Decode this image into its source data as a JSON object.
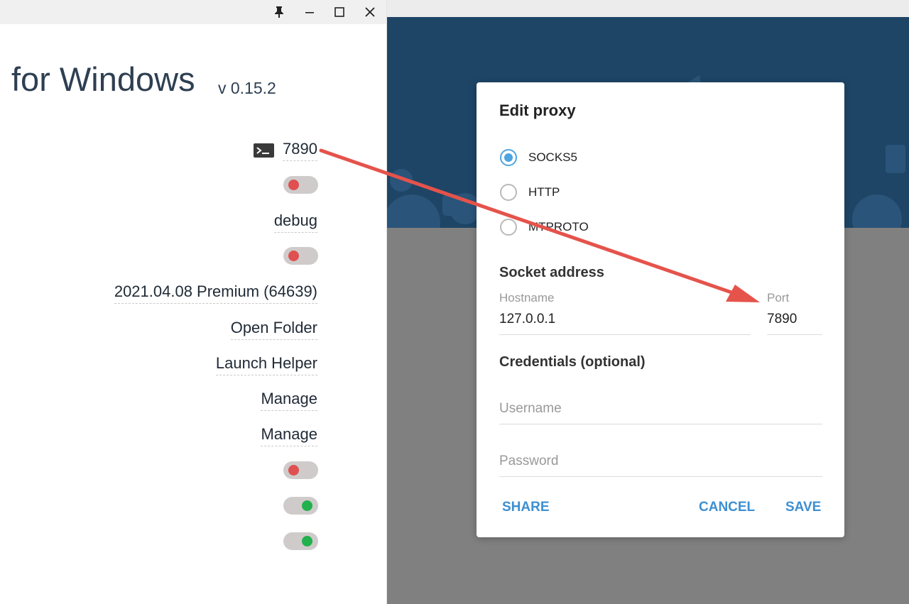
{
  "left_app": {
    "title": "for Windows",
    "version": "v 0.15.2",
    "port": "7890",
    "settings": [
      {
        "type": "toggle",
        "state": "off"
      },
      {
        "type": "link",
        "label": "debug"
      },
      {
        "type": "toggle",
        "state": "off"
      },
      {
        "type": "link",
        "label": "2021.04.08 Premium (64639)"
      },
      {
        "type": "link",
        "label": "Open Folder"
      },
      {
        "type": "link",
        "label": "Launch Helper"
      },
      {
        "type": "link",
        "label": "Manage"
      },
      {
        "type": "link",
        "label": "Manage"
      },
      {
        "type": "toggle",
        "state": "off"
      },
      {
        "type": "toggle",
        "state": "on"
      },
      {
        "type": "toggle",
        "state": "on"
      }
    ],
    "colors": {
      "toggle_off": "#e05050",
      "toggle_on": "#22b14c"
    }
  },
  "dialog": {
    "title": "Edit proxy",
    "proxy_types": [
      {
        "label": "SOCKS5",
        "selected": true
      },
      {
        "label": "HTTP",
        "selected": false
      },
      {
        "label": "MTPROTO",
        "selected": false
      }
    ],
    "socket_section": "Socket address",
    "hostname_label": "Hostname",
    "hostname_value": "127.0.0.1",
    "port_label": "Port",
    "port_value": "7890",
    "credentials_section": "Credentials (optional)",
    "username_placeholder": "Username",
    "password_placeholder": "Password",
    "buttons": {
      "share": "SHARE",
      "cancel": "CANCEL",
      "save": "SAVE"
    },
    "accent_color": "#3d8fd1"
  },
  "annotation": {
    "arrow_color": "#e5534b"
  }
}
